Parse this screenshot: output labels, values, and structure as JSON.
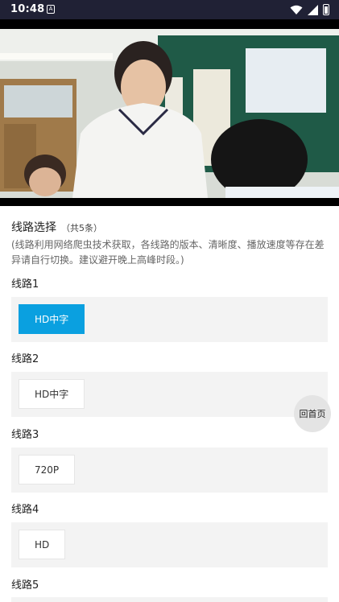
{
  "status_bar": {
    "time": "10:48",
    "notification": "A",
    "icons": [
      "wifi-icon",
      "signal-icon",
      "battery-icon"
    ]
  },
  "video": {
    "description_icon": "video-frame"
  },
  "routes_header": {
    "title": "线路选择",
    "count": "（共5条）",
    "notice": "(线路利用网络爬虫技术获取，各线路的版本、清晰度、播放速度等存在差异请自行切换。建议避开晚上高峰时段。)"
  },
  "routes": [
    {
      "label": "线路1",
      "episode": "HD中字",
      "active": true
    },
    {
      "label": "线路2",
      "episode": "HD中字",
      "active": false
    },
    {
      "label": "线路3",
      "episode": "720P",
      "active": false
    },
    {
      "label": "线路4",
      "episode": "HD",
      "active": false
    },
    {
      "label": "线路5",
      "episode": "",
      "active": false
    }
  ],
  "floating": {
    "back_home": "回首页"
  },
  "colors": {
    "accent": "#0aa0e0",
    "status_bar_bg": "#202135",
    "panel_bg": "#f3f3f3"
  }
}
